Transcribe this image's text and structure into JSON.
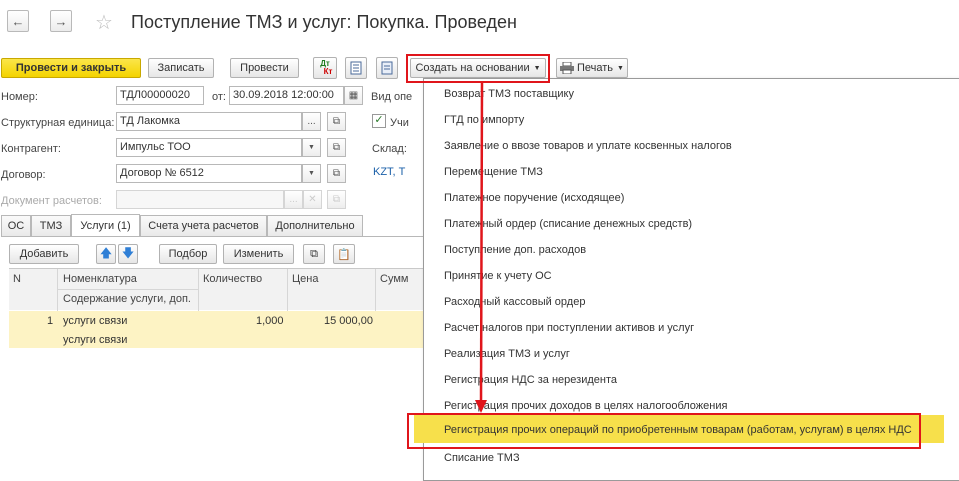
{
  "window": {
    "title": "Поступление ТМЗ и услуг: Покупка. Проведен",
    "back_icon": "←",
    "forward_icon": "→",
    "star_icon": "☆"
  },
  "toolbar": {
    "post_close": "Провести и закрыть",
    "save": "Записать",
    "post": "Провести",
    "dt_kt_top": "Дт",
    "dt_kt_bottom": "Кт",
    "create_based": "Создать на основании",
    "print": "Печать"
  },
  "form": {
    "number_label": "Номер:",
    "number_value": "ТДЛ00000020",
    "date_label": "от:",
    "date_value": "30.09.2018 12:00:00",
    "op_type_label": "Вид опе",
    "unit_label": "Структурная единица:",
    "unit_value": "ТД Лакомка",
    "counterparty_label": "Контрагент:",
    "counterparty_value": "Импульс ТОО",
    "contract_label": "Договор:",
    "contract_value": "Договор № 6512",
    "settlement_doc_label": "Документ расчетов:",
    "checkbox_label": "Учи",
    "warehouse_label": "Склад:",
    "currency_link": "KZT, Т"
  },
  "tabs": [
    "ОС",
    "ТМЗ",
    "Услуги (1)",
    "Счета учета расчетов",
    "Дополнительно"
  ],
  "table_toolbar": {
    "add": "Добавить",
    "pick": "Подбор",
    "edit": "Изменить"
  },
  "table": {
    "headers": {
      "n": "N",
      "item": "Номенклатура",
      "item_sub": "Содержание услуги, доп.",
      "qty": "Количество",
      "price": "Цена",
      "sum": "Сумм"
    },
    "rows": [
      {
        "n": "1",
        "item": "услуги связи",
        "item_sub": "услуги связи",
        "qty": "1,000",
        "price": "15 000,00"
      }
    ]
  },
  "dropdown_items": [
    "Возврат ТМЗ поставщику",
    "ГТД по импорту",
    "Заявление о ввозе товаров и уплате косвенных налогов",
    "Перемещение ТМЗ",
    "Платежное поручение (исходящее)",
    "Платежный ордер (списание денежных средств)",
    "Поступление доп. расходов",
    "Принятие к учету ОС",
    "Расходный кассовый ордер",
    "Расчет налогов при поступлении активов и услуг",
    "Реализация ТМЗ и услуг",
    "Регистрация НДС за нерезидента",
    "Регистрация прочих доходов в целях налогообложения",
    "Регистрация прочих операций по приобретенным товарам (работам, услугам) в целях НДС",
    "Списание ТМЗ"
  ],
  "highlighted_item_index": 13,
  "colors": {
    "accent_yellow": "#f4d300",
    "row_highlight": "#fdf3c4",
    "menu_highlight": "#f7e04b",
    "annotation_red": "#e0151b",
    "link_blue": "#1a5fa8"
  }
}
